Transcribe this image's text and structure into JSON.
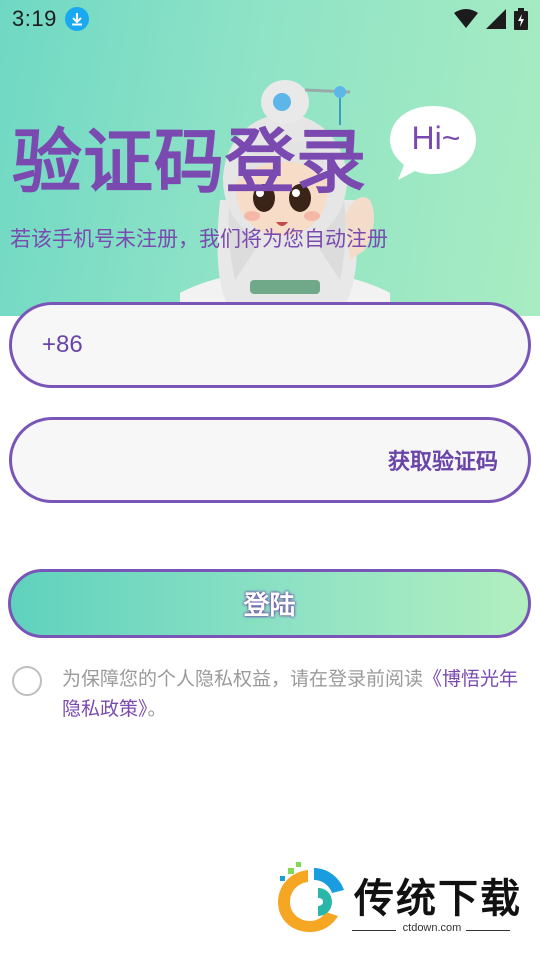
{
  "status_bar": {
    "time": "3:19",
    "icons": [
      "download-icon",
      "wifi-icon",
      "signal-icon",
      "battery-icon"
    ]
  },
  "header": {
    "title": "验证码登录",
    "subtitle": "若该手机号未注册，我们将为您自动注册",
    "bubble_text": "Hi~"
  },
  "form": {
    "phone_prefix": "+86",
    "phone_value": "",
    "code_value": "",
    "get_code_label": "获取验证码",
    "login_label": "登陆"
  },
  "agreement": {
    "checked": false,
    "text": "为保障您的个人隐私权益，请在登录前阅读",
    "policy_link": "《博悟光年隐私政策》",
    "suffix": "。"
  },
  "watermark": {
    "name": "传统下载",
    "domain": "ctdown.com"
  },
  "colors": {
    "accent": "#7a4ab0",
    "header_bg": "#8fe3c6",
    "button_gradient_start": "#5fd2bd",
    "button_gradient_end": "#b2efbf",
    "download_badge": "#1aa8f0"
  }
}
